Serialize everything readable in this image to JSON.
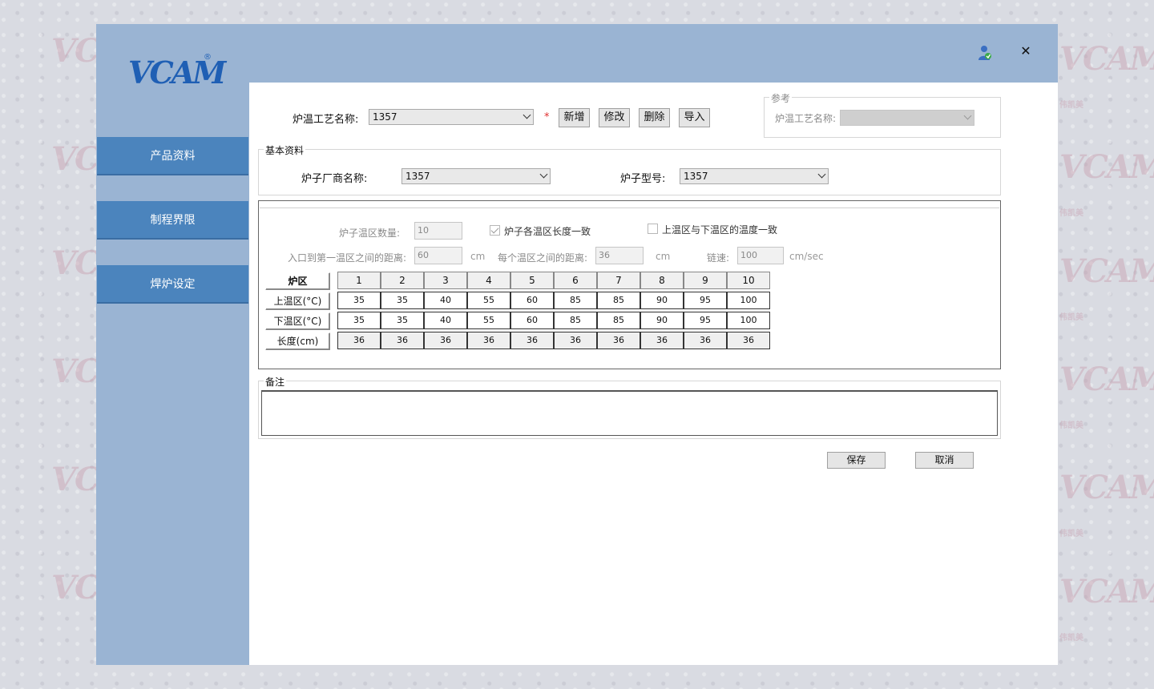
{
  "watermark": {
    "text": "VCAM",
    "sub": "伟凯美"
  },
  "app": {
    "logo_text": "VCAM",
    "logo_mark": "®"
  },
  "sidebar": {
    "items": [
      {
        "label": "产品资料"
      },
      {
        "label": "制程界限"
      },
      {
        "label": "焊炉设定"
      }
    ]
  },
  "header": {
    "close_glyph": "✕"
  },
  "top": {
    "process_label": "炉温工艺名称:",
    "process_value": "1357",
    "required_mark": "*",
    "buttons": {
      "add": "新增",
      "edit": "修改",
      "delete": "删除",
      "import": "导入"
    }
  },
  "reference": {
    "legend": "参考",
    "process_label": "炉温工艺名称:",
    "process_value": ""
  },
  "basic": {
    "legend": "基本资料",
    "vendor_label": "炉子厂商名称:",
    "vendor_value": "1357",
    "model_label": "炉子型号:",
    "model_value": "1357"
  },
  "zones": {
    "count_label": "炉子温区数量:",
    "count_value": "10",
    "same_length_label": "炉子各温区长度一致",
    "same_length_checked": true,
    "same_temp_label": "上温区与下温区的温度一致",
    "same_temp_checked": false,
    "entry_dist_label": "入口到第一温区之间的距离:",
    "entry_dist_value": "60",
    "entry_dist_unit": "cm",
    "zone_dist_label": "每个温区之间的距离:",
    "zone_dist_value": "36",
    "zone_dist_unit": "cm",
    "speed_label": "链速:",
    "speed_value": "100",
    "speed_unit": "cm/sec"
  },
  "table": {
    "row_headers": [
      "炉区",
      "上温区(°C)",
      "下温区(°C)",
      "长度(cm)"
    ],
    "zone_numbers": [
      "1",
      "2",
      "3",
      "4",
      "5",
      "6",
      "7",
      "8",
      "9",
      "10"
    ],
    "upper": [
      "35",
      "35",
      "40",
      "55",
      "60",
      "85",
      "85",
      "90",
      "95",
      "100"
    ],
    "lower": [
      "35",
      "35",
      "40",
      "55",
      "60",
      "85",
      "85",
      "90",
      "95",
      "100"
    ],
    "length": [
      "36",
      "36",
      "36",
      "36",
      "36",
      "36",
      "36",
      "36",
      "36",
      "36"
    ]
  },
  "notes": {
    "legend": "备注",
    "value": ""
  },
  "actions": {
    "save": "保存",
    "cancel": "取消"
  }
}
